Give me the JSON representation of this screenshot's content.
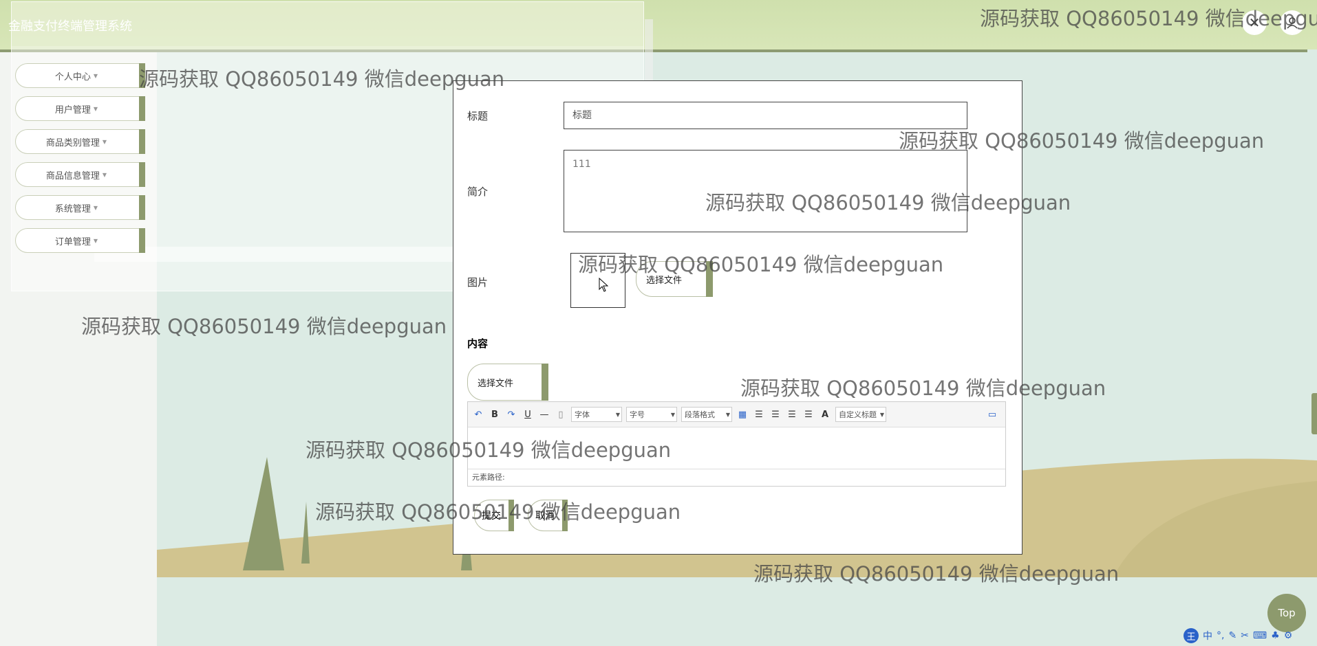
{
  "header": {
    "app_title": "金融支付终端管理系统",
    "close_icon": "close-icon",
    "user_icon": "user-icon"
  },
  "sidebar": {
    "items": [
      {
        "label": "个人中心"
      },
      {
        "label": "用户管理"
      },
      {
        "label": "商品类别管理"
      },
      {
        "label": "商品信息管理"
      },
      {
        "label": "系统管理"
      },
      {
        "label": "订单管理"
      }
    ]
  },
  "form": {
    "title_label": "标题",
    "title_value": "标题",
    "intro_label": "简介",
    "intro_value": "111",
    "image_label": "图片",
    "image_button": "选择文件",
    "content_label": "内容",
    "content_file_button": "选择文件",
    "editor": {
      "font_select": "字体",
      "size_select": "字号",
      "paragraph_select": "段落格式",
      "custom_title_select": "自定义标题",
      "element_path": "元素路径:"
    },
    "submit_label": "提交",
    "cancel_label": "取消"
  },
  "watermark_text": "源码获取 QQ86050149 微信deepguan",
  "top_button": "Top",
  "ime": {
    "logo": "王",
    "mode": "中"
  },
  "colors": {
    "accent": "#8d9a6d",
    "header": "#d4e3b2",
    "background": "#dcebe4",
    "hill": "#d1c48f"
  }
}
